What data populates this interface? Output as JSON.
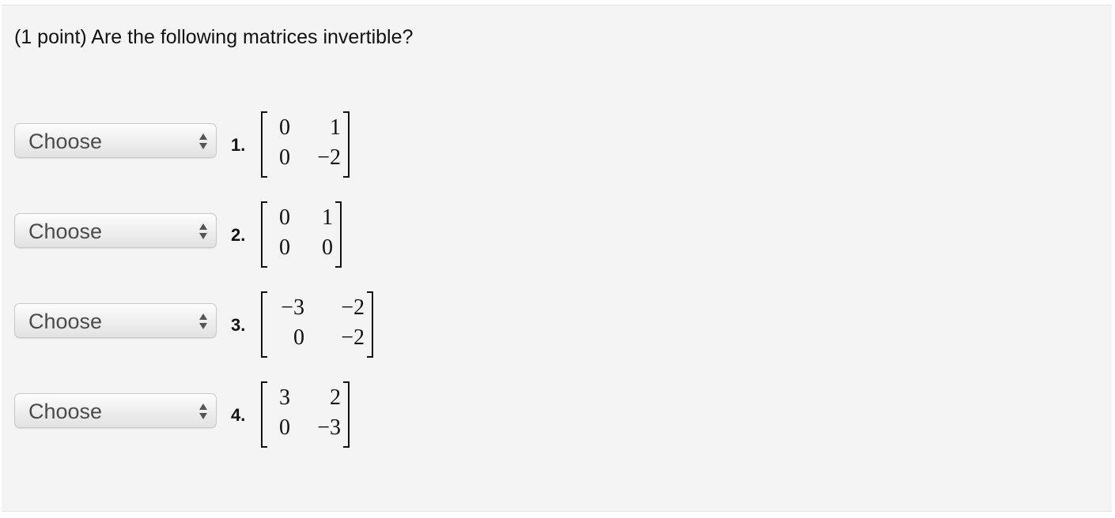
{
  "question": "(1 point) Are the following matrices invertible?",
  "select_default": "Choose",
  "items": [
    {
      "number": "1.",
      "matrix": [
        [
          "0",
          "1"
        ],
        [
          "0",
          "−2"
        ]
      ]
    },
    {
      "number": "2.",
      "matrix": [
        [
          "0",
          "1"
        ],
        [
          "0",
          "0"
        ]
      ]
    },
    {
      "number": "3.",
      "matrix": [
        [
          "−3",
          "−2"
        ],
        [
          "0",
          "−2"
        ]
      ]
    },
    {
      "number": "4.",
      "matrix": [
        [
          "3",
          "2"
        ],
        [
          "0",
          "−3"
        ]
      ]
    }
  ],
  "icons": {
    "select_arrows": "up-down-arrows-icon"
  },
  "colors": {
    "panel_background": "#f4f4f4",
    "text": "#111111",
    "select_text": "#4b4b4b"
  }
}
